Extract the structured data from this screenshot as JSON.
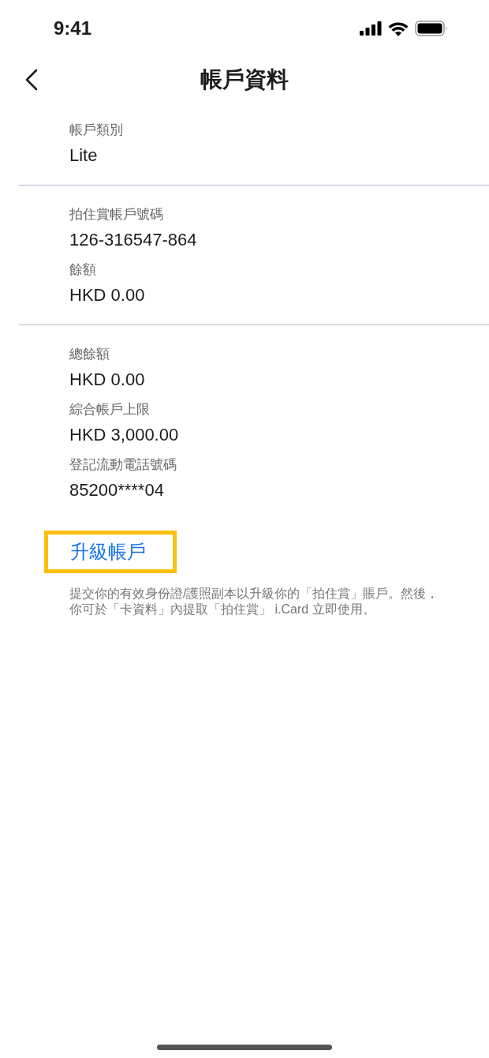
{
  "status_bar": {
    "time": "9:41"
  },
  "nav": {
    "title": "帳戶資料"
  },
  "sections": [
    {
      "fields": [
        {
          "label": "帳戶類別",
          "value": "Lite"
        }
      ]
    },
    {
      "fields": [
        {
          "label": "拍住賞帳戶號碼",
          "value": "126-316547-864"
        },
        {
          "label": "餘額",
          "value": "HKD 0.00"
        }
      ]
    },
    {
      "fields": [
        {
          "label": "總餘額",
          "value": "HKD 0.00"
        },
        {
          "label": "綜合帳戶上限",
          "value": "HKD 3,000.00"
        },
        {
          "label": "登記流動電話號碼",
          "value": "85200****04"
        }
      ]
    }
  ],
  "upgrade_link": {
    "label": "升級帳戶",
    "highlighted": true
  },
  "note": "提交你的有效身份證/護照副本以升級你的「拍住賞」賬戶。然後，你可於「卡資料」內提取「拍住賞」 i.Card 立即使用。"
}
